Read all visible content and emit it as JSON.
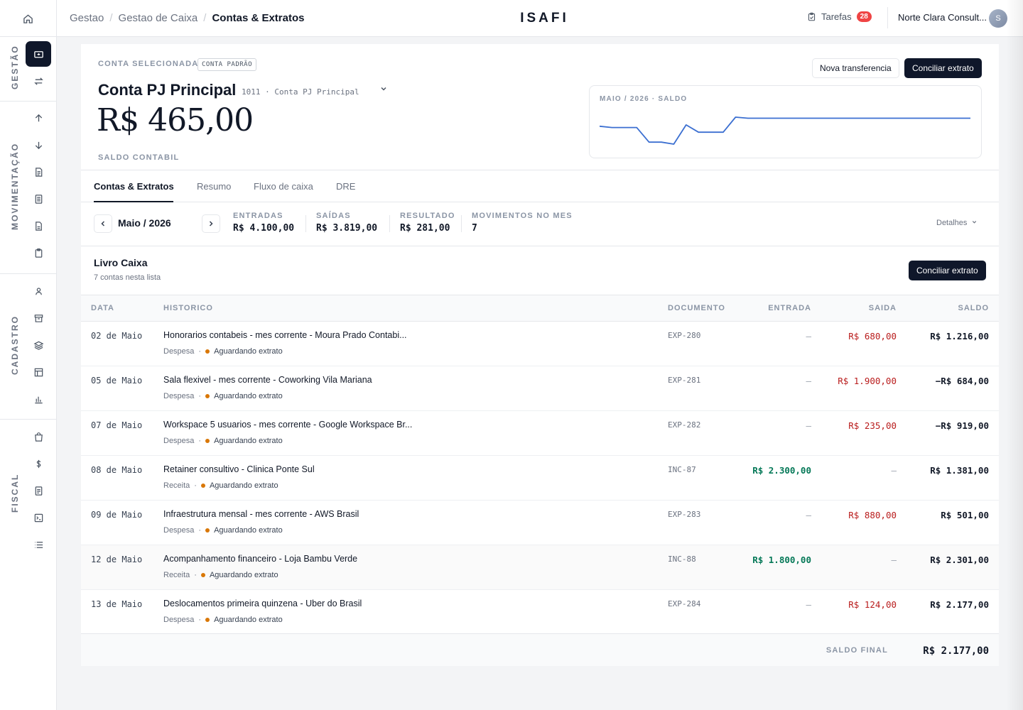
{
  "brand": "ISAFI",
  "breadcrumb": [
    "Gestao",
    "Gestao de Caixa",
    "Contas & Extratos"
  ],
  "tasks": {
    "label": "Tarefas",
    "count": "28"
  },
  "company": {
    "name": "Norte Clara Consult...",
    "initial": "S"
  },
  "sidebar": {
    "sections": [
      "GESTÃO",
      "MOVIMENTAÇÃO",
      "CADASTRO",
      "FISCAL"
    ]
  },
  "account": {
    "selected_label": "CONTA SELECIONADA",
    "default_tag": "CONTA PADRÃO",
    "name": "Conta PJ Principal",
    "code": "1011 · Conta PJ Principal",
    "balance": "R$ 465,00",
    "balance_label": "SALDO CONTABIL"
  },
  "actions": {
    "transfer": "Nova transferencia",
    "reconcile": "Conciliar extrato"
  },
  "sparkline": {
    "label": "MAIO / 2026 · SALDO",
    "color": "#3b6fd1",
    "values": [
      1216,
      -684,
      -919,
      1381,
      501,
      2301,
      2177
    ]
  },
  "tabs": [
    "Contas & Extratos",
    "Resumo",
    "Fluxo de caixa",
    "DRE"
  ],
  "period": {
    "name": "Maio / 2026",
    "stats": [
      {
        "label": "ENTRADAS",
        "value": "R$ 4.100,00"
      },
      {
        "label": "SAÍDAS",
        "value": "R$ 3.819,00"
      },
      {
        "label": "RESULTADO",
        "value": "R$ 281,00"
      },
      {
        "label": "MOVIMENTOS NO MES",
        "value": "7"
      }
    ],
    "details": "Detalhes"
  },
  "book": {
    "title": "Livro Caixa",
    "subtitle": "7 contas nesta lista",
    "reconcile": "Conciliar extrato",
    "columns": [
      "DATA",
      "HISTORICO",
      "DOCUMENTO",
      "ENTRADA",
      "SAIDA",
      "SALDO"
    ],
    "rows": [
      {
        "date": "02 de Maio",
        "hist": "Honorarios contabeis - mes corrente - Moura Prado Contabi...",
        "type": "Despesa",
        "status": "Aguardando extrato",
        "doc": "EXP-280",
        "in": "—",
        "out": "R$ 680,00",
        "bal": "R$ 1.216,00"
      },
      {
        "date": "05 de Maio",
        "hist": "Sala flexivel - mes corrente - Coworking Vila Mariana",
        "type": "Despesa",
        "status": "Aguardando extrato",
        "doc": "EXP-281",
        "in": "—",
        "out": "R$ 1.900,00",
        "bal": "−R$ 684,00"
      },
      {
        "date": "07 de Maio",
        "hist": "Workspace 5 usuarios - mes corrente - Google Workspace Br...",
        "type": "Despesa",
        "status": "Aguardando extrato",
        "doc": "EXP-282",
        "in": "—",
        "out": "R$ 235,00",
        "bal": "−R$ 919,00"
      },
      {
        "date": "08 de Maio",
        "hist": "Retainer consultivo - Clinica Ponte Sul",
        "type": "Receita",
        "status": "Aguardando extrato",
        "doc": "INC-87",
        "in": "R$ 2.300,00",
        "out": "—",
        "bal": "R$ 1.381,00"
      },
      {
        "date": "09 de Maio",
        "hist": "Infraestrutura mensal - mes corrente - AWS Brasil",
        "type": "Despesa",
        "status": "Aguardando extrato",
        "doc": "EXP-283",
        "in": "—",
        "out": "R$ 880,00",
        "bal": "R$ 501,00"
      },
      {
        "date": "12 de Maio",
        "hist": "Acompanhamento financeiro - Loja Bambu Verde",
        "type": "Receita",
        "status": "Aguardando extrato",
        "doc": "INC-88",
        "in": "R$ 1.800,00",
        "out": "—",
        "bal": "R$ 2.301,00"
      },
      {
        "date": "13 de Maio",
        "hist": "Deslocamentos primeira quinzena - Uber do Brasil",
        "type": "Despesa",
        "status": "Aguardando extrato",
        "doc": "EXP-284",
        "in": "—",
        "out": "R$ 124,00",
        "bal": "R$ 2.177,00"
      }
    ],
    "final_label": "SALDO FINAL",
    "final_value": "R$ 2.177,00"
  },
  "colors": {
    "accent": "#0f172a",
    "positive": "#047857",
    "negative": "#b91c1c",
    "badge": "#ef4444",
    "pending": "#d97706"
  }
}
